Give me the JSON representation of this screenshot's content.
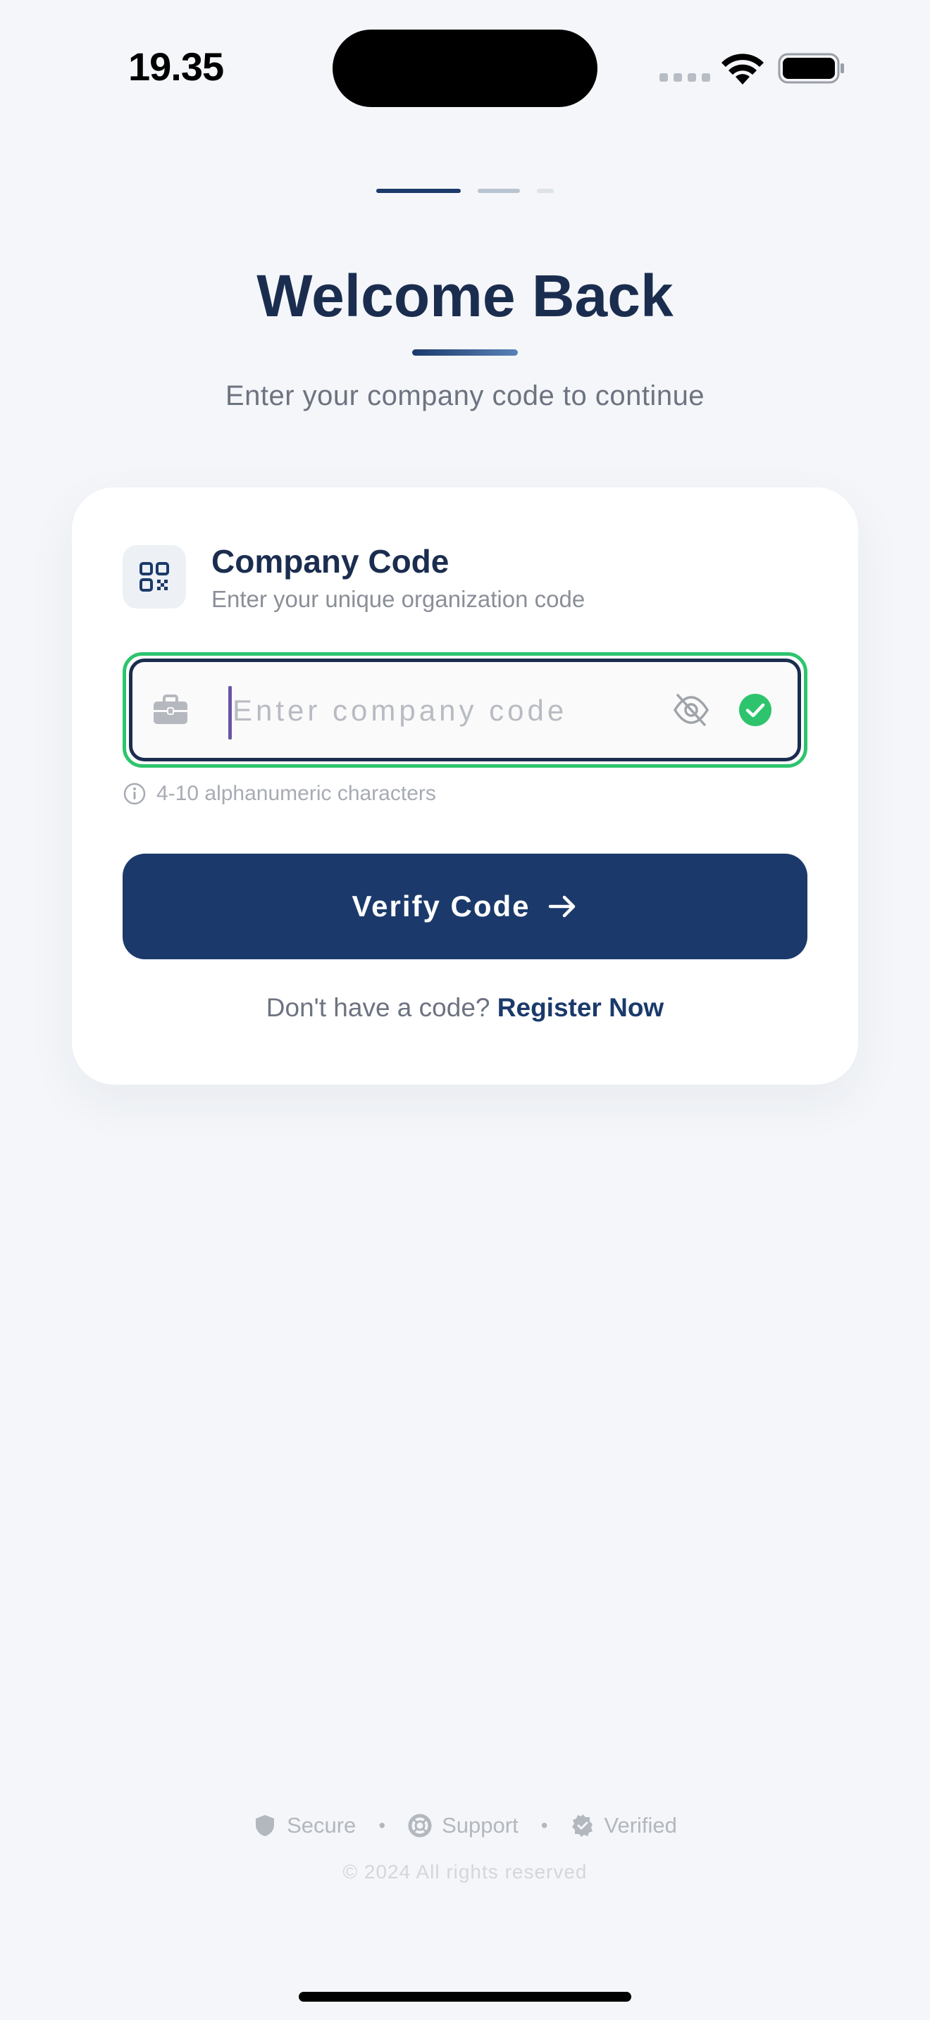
{
  "status_bar": {
    "time": "19.35"
  },
  "progress": {
    "steps": 3,
    "current_step": 1
  },
  "header": {
    "title": "Welcome Back",
    "subtitle": "Enter your company code to continue"
  },
  "card": {
    "icon": "qr-code-icon",
    "title": "Company Code",
    "description": "Enter your unique organization code",
    "input": {
      "value": "",
      "placeholder": "Enter company code",
      "leading_icon": "briefcase-icon",
      "visibility_icon": "eye-off-icon",
      "status_icon": "check-circle-icon"
    },
    "hint": "4-10 alphanumeric characters",
    "verify_button_label": "Verify Code",
    "register_prompt": "Don't have a code?",
    "register_link": "Register Now"
  },
  "footer": {
    "badges": [
      {
        "label": "Secure",
        "icon": "shield-icon"
      },
      {
        "label": "Support",
        "icon": "lifebuoy-icon"
      },
      {
        "label": "Verified",
        "icon": "verified-badge-icon"
      }
    ],
    "separator": "•",
    "copyright": "© 2024 All rights reserved"
  },
  "colors": {
    "background": "#f4f6f9",
    "primary": "#1b3a6b",
    "title": "#1b2d4f",
    "success": "#2ec46d",
    "muted": "#6d7380"
  }
}
